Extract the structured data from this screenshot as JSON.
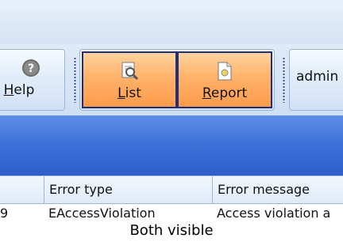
{
  "toolbar": {
    "help_label_prefix": "",
    "help_mnemonic": "H",
    "help_label_rest": "elp",
    "list_mnemonic": "L",
    "list_label_rest": "ist",
    "report_mnemonic": "R",
    "report_label_rest": "eport",
    "user_label": "admin"
  },
  "grid": {
    "columns": [
      "",
      "Error type",
      "Error message"
    ],
    "rows": [
      {
        "id_partial": "9",
        "error_type": "EAccessViolation",
        "error_message": "Access violation a"
      }
    ]
  },
  "caption": "Both visible"
}
